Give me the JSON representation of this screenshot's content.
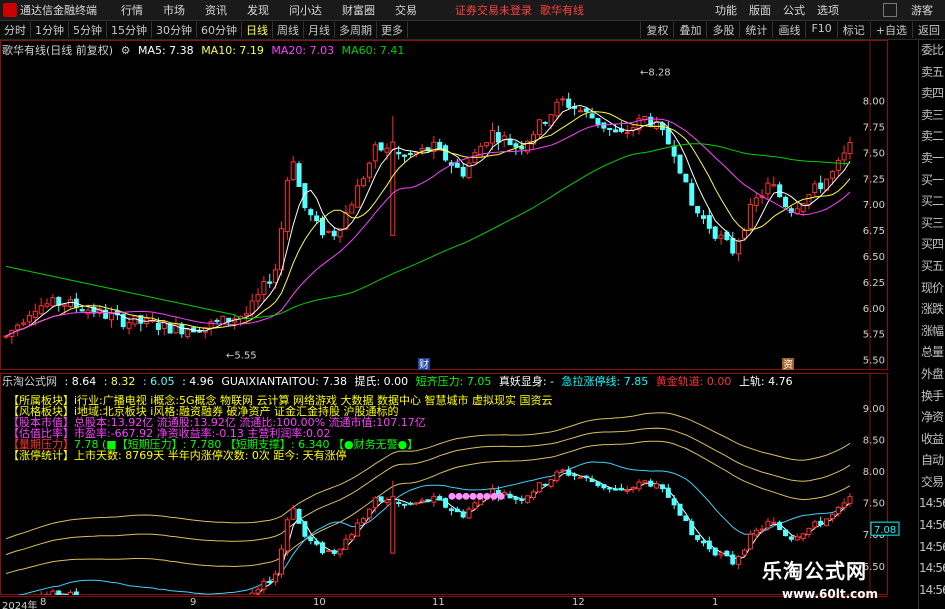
{
  "menubar": {
    "app_title": "通达信金融终端",
    "items": [
      "行情",
      "市场",
      "资讯",
      "发现",
      "问小达",
      "财富圈",
      "交易"
    ],
    "status": "证券交易未登录",
    "stock": "歌华有线",
    "right_items": [
      "功能",
      "版面",
      "公式",
      "选项"
    ],
    "guest": "游客"
  },
  "toolbar": {
    "periods": [
      "分时",
      "1分钟",
      "5分钟",
      "15分钟",
      "30分钟",
      "60分钟",
      "日线",
      "周线",
      "月线",
      "多周期",
      "更多"
    ],
    "active": "日线",
    "tools": [
      "复权",
      "叠加",
      "多股",
      "统计",
      "画线",
      "F10",
      "标记",
      "+自选",
      "返回"
    ]
  },
  "main_legend": {
    "title": "歌华有线(日线 前复权)",
    "ma5": "MA5: 7.38",
    "ma10": "MA10: 7.19",
    "ma20": "MA20: 7.03",
    "ma60": "MA60: 7.41"
  },
  "main_axis": [
    "8.00",
    "7.75",
    "7.50",
    "7.25",
    "7.00",
    "6.75",
    "6.50",
    "6.25",
    "6.00",
    "5.75",
    "5.50"
  ],
  "main_annot": {
    "high": "8.28",
    "low": "5.55",
    "cai1": "财",
    "cai2": "资"
  },
  "sub_legend": {
    "name": "乐淘公式网",
    "v1": ": 8.64",
    "v2": ": 8.32",
    "v3": ": 6.05",
    "v4": ": 4.96",
    "code": "GUAIXIANTAITOU: 7.38",
    "tip": "提氏: 0.00",
    "shortpress": "短齐压力: 7.05",
    "yaoxian": "真妖显身: -",
    "limitline": "急拉涨停线: 7.85",
    "gold": "黄金轨道: 0.00",
    "upper": "上轨: 4.76"
  },
  "info_lines": [
    {
      "label": "【所属板块】",
      "text": "i行业:广播电视    i概念:5G概念 物联网 云计算 网络游戏 大数据 数据中心 智慧城市 虚拟现实 国资云",
      "color": "#ffff00"
    },
    {
      "label": "【风格板块】",
      "text": "i地域:北京板块    i风格:融资融券 破净资产 证金汇金持股 沪股通标的",
      "color": "#ffff00"
    },
    {
      "label": "【股本市值】",
      "text": "总股本:13.92亿    流通股:13.92亿    流通比:100.00%    流通市值:107.17亿",
      "color": "#ff40ff"
    },
    {
      "label": "【估值比率】",
      "text": "市盈率:-667.92    净资收益率:-0.13    主营利润率:0.02",
      "color": "#ff40ff"
    },
    {
      "label": "【量期压力】",
      "text": "7.78 (■【短期压力】: 7.780 【短期支撑】: 6.340 【●财务无警●】",
      "color": "#00ff00"
    },
    {
      "label": "【涨停统计】",
      "text": "上市天数: 8769天  半年内涨停次数: 0次  距今: 天有涨停",
      "color": "#ffff00"
    }
  ],
  "sub_axis": [
    "9.00",
    "8.50",
    "8.00",
    "7.50",
    "7.00",
    "6.50"
  ],
  "current_price": "7.08",
  "dates": [
    "2024年",
    "8",
    "9",
    "10",
    "11",
    "12",
    "1"
  ],
  "side_items": [
    "委比",
    "卖五",
    "卖四",
    "卖三",
    "卖二",
    "卖一",
    "买一",
    "买二",
    "买三",
    "买四",
    "买五",
    "现价",
    "涨跌",
    "涨幅",
    "总量",
    "外盘",
    "换手",
    "净资",
    "收益",
    "自动",
    "交易",
    "14:56",
    "14:56",
    "14:56",
    "14:56",
    "14:56"
  ],
  "watermark": {
    "title": "乐淘公式网",
    "url": "www.60lt.com"
  },
  "colors": {
    "up": "#ff3030",
    "down": "#54ffff",
    "ma5": "#ffffff",
    "ma10": "#ffff40",
    "ma20": "#ff40ff",
    "ma60": "#00d000"
  }
}
